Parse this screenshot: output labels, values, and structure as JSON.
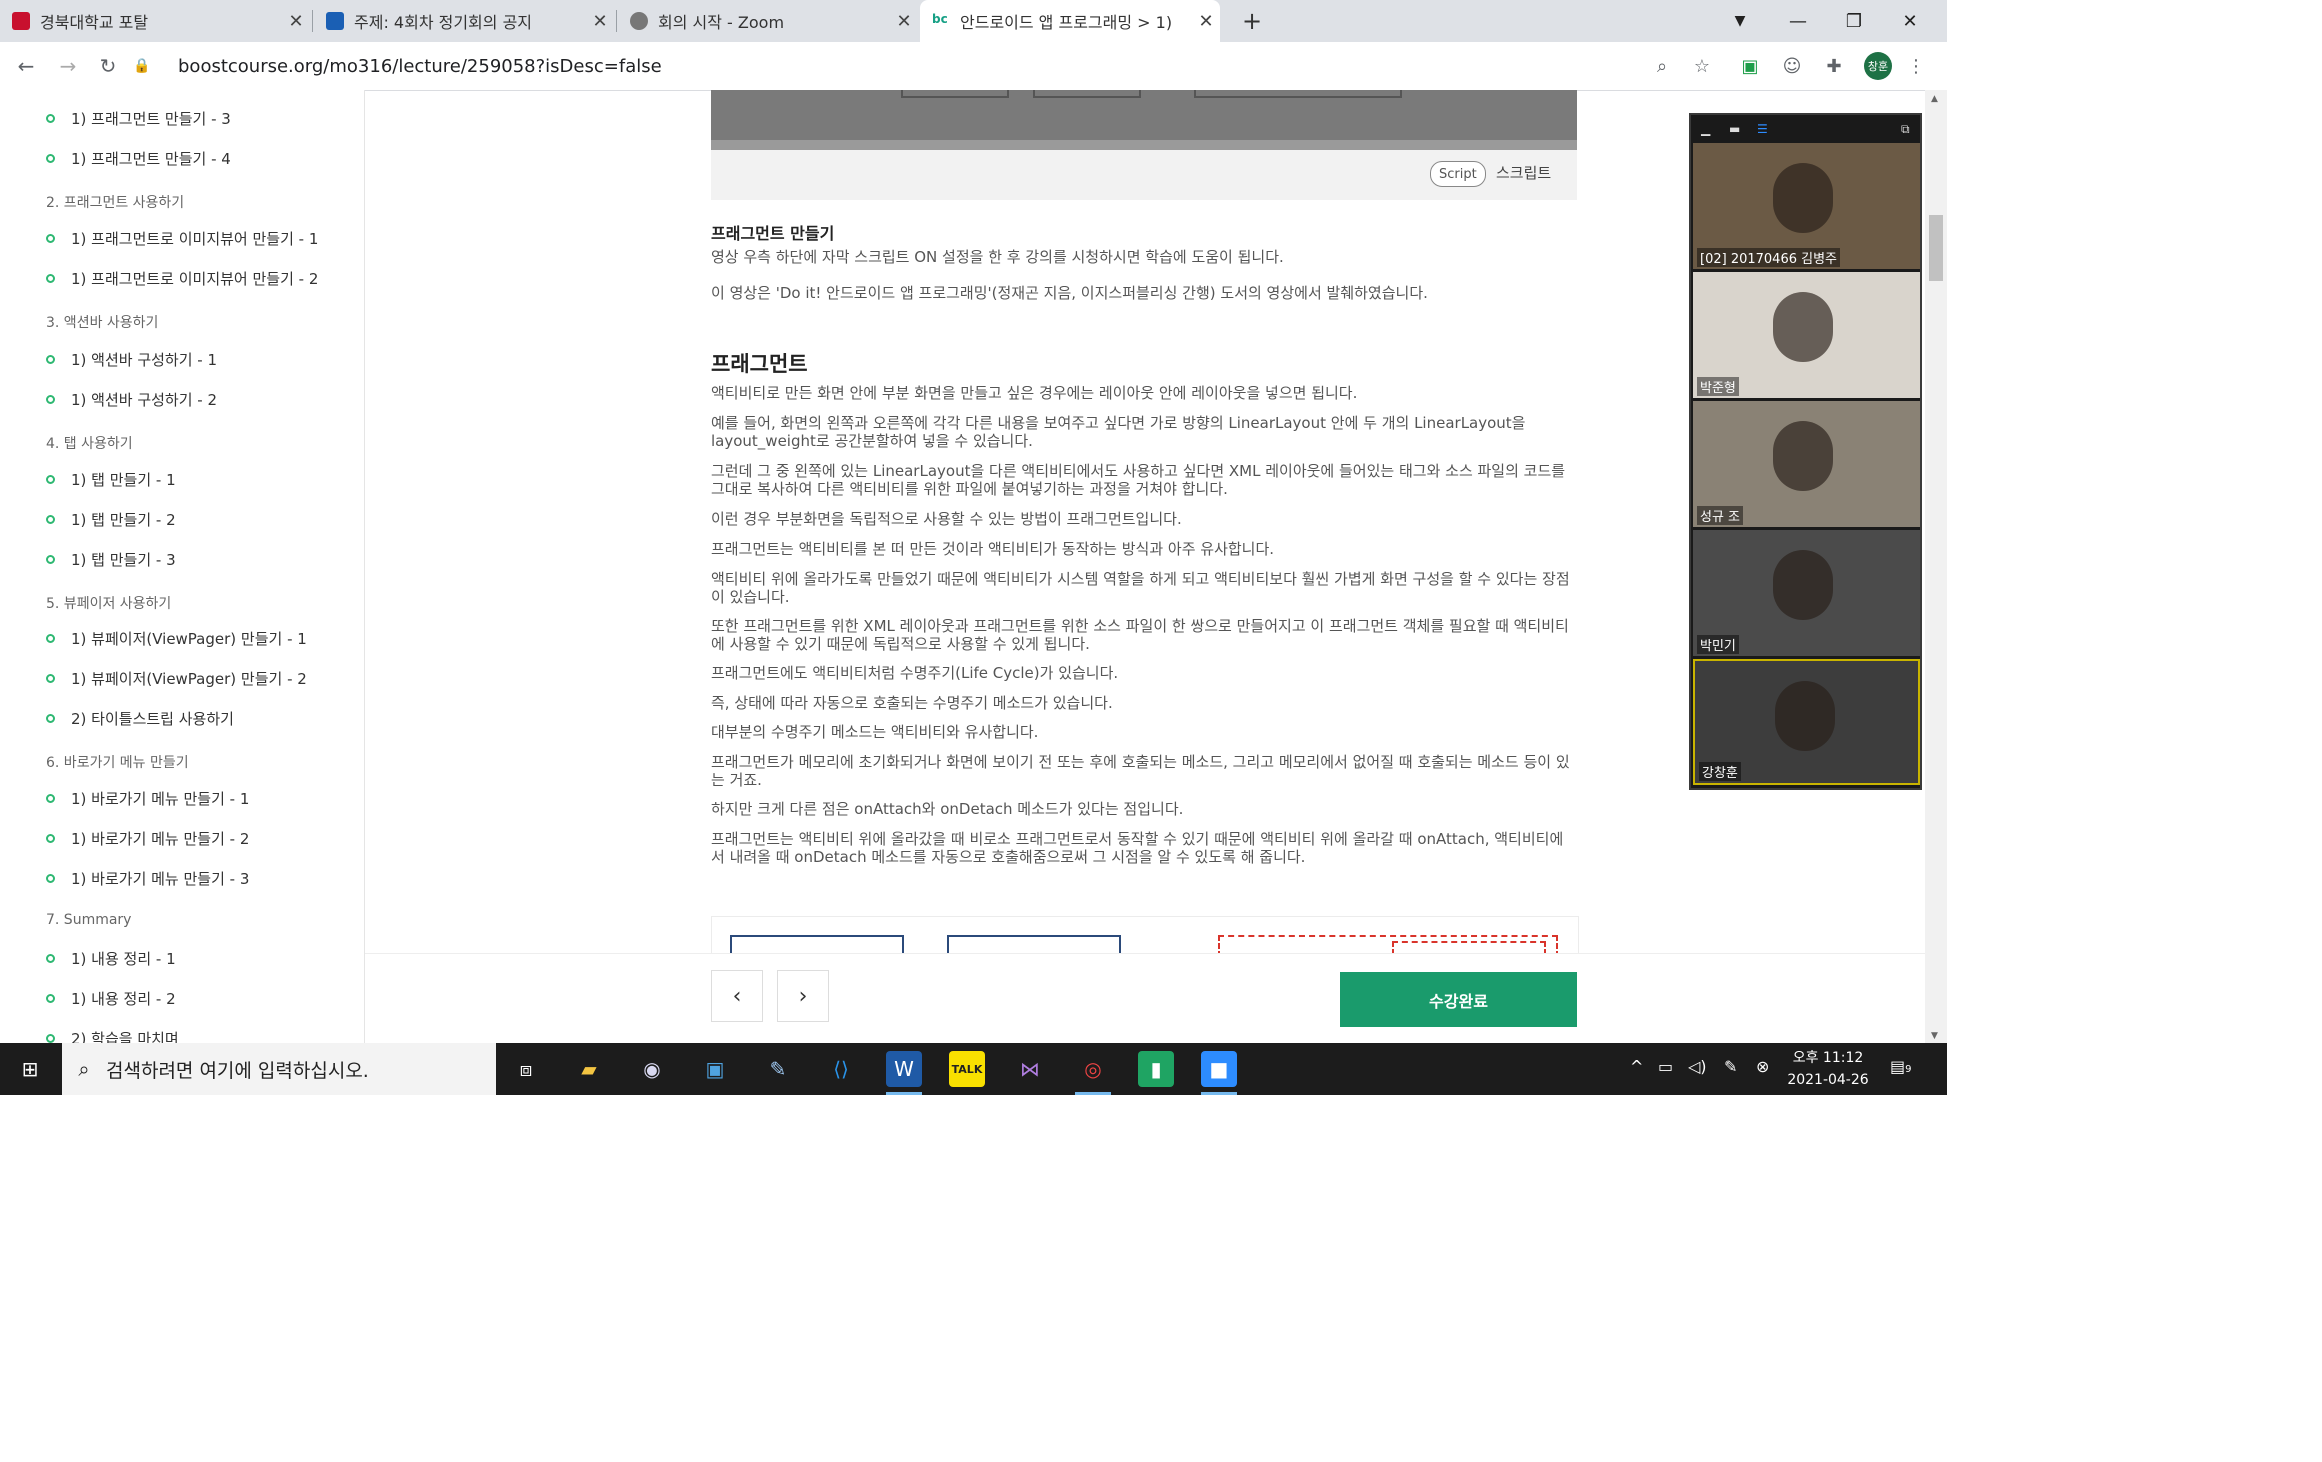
{
  "browser": {
    "tabs": [
      {
        "title": "경북대학교 포탈",
        "favicon_color": "#c8102e",
        "active": false
      },
      {
        "title": "주제: 4회차 정기회의 공지",
        "favicon_color": "#1a5fb4",
        "active": false
      },
      {
        "title": "회의 시작 - Zoom",
        "favicon_color": "#777777",
        "active": false
      },
      {
        "title": "안드로이드 앱 프로그래밍 > 1)",
        "favicon_color": "#16a085",
        "favicon_text": "bc",
        "active": true
      }
    ],
    "new_tab_label": "+",
    "url": "boostcourse.org/mo316/lecture/259058?isDesc=false",
    "profile_label": "창훈"
  },
  "sidebar": {
    "entries": [
      {
        "type": "item",
        "label": "1) 프래그먼트 만들기 - 3"
      },
      {
        "type": "item",
        "label": "1) 프래그먼트 만들기 - 4"
      },
      {
        "type": "section",
        "label": "2. 프래그먼트 사용하기"
      },
      {
        "type": "item",
        "label": "1) 프래그먼트로 이미지뷰어 만들기 - 1"
      },
      {
        "type": "item",
        "label": "1) 프래그먼트로 이미지뷰어 만들기 - 2"
      },
      {
        "type": "section",
        "label": "3. 액션바 사용하기"
      },
      {
        "type": "item",
        "label": "1) 액션바 구성하기 - 1"
      },
      {
        "type": "item",
        "label": "1) 액션바 구성하기 - 2"
      },
      {
        "type": "section",
        "label": "4. 탭 사용하기"
      },
      {
        "type": "item",
        "label": "1) 탭 만들기 - 1"
      },
      {
        "type": "item",
        "label": "1) 탭 만들기 - 2"
      },
      {
        "type": "item",
        "label": "1) 탭 만들기 - 3"
      },
      {
        "type": "section",
        "label": "5. 뷰페이저 사용하기"
      },
      {
        "type": "item",
        "label": "1) 뷰페이저(ViewPager) 만들기 - 1"
      },
      {
        "type": "item",
        "label": "1) 뷰페이저(ViewPager) 만들기 - 2"
      },
      {
        "type": "item",
        "label": "2) 타이틀스트립 사용하기"
      },
      {
        "type": "section",
        "label": "6. 바로가기 메뉴 만들기"
      },
      {
        "type": "item",
        "label": "1) 바로가기 메뉴 만들기 - 1"
      },
      {
        "type": "item",
        "label": "1) 바로가기 메뉴 만들기 - 2"
      },
      {
        "type": "item",
        "label": "1) 바로가기 메뉴 만들기 - 3"
      },
      {
        "type": "section",
        "label": "7. Summary"
      },
      {
        "type": "item",
        "label": "1) 내용 정리 - 1"
      },
      {
        "type": "item",
        "label": "1) 내용 정리 - 2"
      },
      {
        "type": "item",
        "label": "2) 학습을 마치며"
      }
    ]
  },
  "content": {
    "script_badge": "Script",
    "script_label": "스크립트",
    "section_title": "프래그먼트 만들기",
    "intro": [
      "영상 우측 하단에 자막 스크립트 ON 설정을 한 후 강의를 시청하시면 학습에 도움이 됩니다.",
      "이 영상은 'Do it! 안드로이드 앱 프로그래밍'(정재곤 지음, 이지스퍼블리싱 간행) 도서의 영상에서 발췌하였습니다."
    ],
    "heading": "프래그먼트",
    "paragraphs": [
      "액티비티로 만든 화면 안에 부분 화면을 만들고 싶은 경우에는 레이아웃 안에 레이아웃을 넣으면 됩니다.",
      "예를 들어, 화면의 왼쪽과 오른쪽에 각각 다른 내용을 보여주고 싶다면 가로 방향의 LinearLayout 안에 두 개의 LinearLayout을 layout_weight로 공간분할하여 넣을 수 있습니다.",
      "그런데 그 중 왼쪽에 있는 LinearLayout을 다른 액티비티에서도 사용하고 싶다면 XML 레이아웃에 들어있는 태그와 소스 파일의 코드를 그대로 복사하여 다른 액티비티를 위한 파일에 붙여넣기하는 과정을 거쳐야 합니다.",
      "이런 경우 부분화면을 독립적으로 사용할 수 있는 방법이 프래그먼트입니다.",
      "프래그먼트는 액티비티를 본 떠 만든 것이라 액티비티가 동작하는 방식과 아주 유사합니다.",
      "액티비티 위에 올라가도록 만들었기 때문에 액티비티가 시스템 역할을 하게 되고 액티비티보다 훨씬 가볍게 화면 구성을 할 수 있다는 장점이 있습니다.",
      "또한 프래그먼트를 위한 XML 레이아웃과 프래그먼트를 위한 소스 파일이 한 쌍으로 만들어지고 이 프래그먼트 객체를 필요할 때 액티비티에 사용할 수 있기 때문에 독립적으로 사용할 수 있게 됩니다.",
      "프래그먼트에도 액티비티처럼 수명주기(Life Cycle)가 있습니다.",
      "즉, 상태에 따라 자동으로 호출되는 수명주기 메소드가 있습니다.",
      "대부분의 수명주기 메소드는 액티비티와 유사합니다.",
      "프래그먼트가 메모리에 초기화되거나 화면에 보이기 전 또는 후에 호출되는 메소드, 그리고 메모리에서 없어질 때 호출되는 메소드 등이 있는 거죠.",
      "하지만 크게 다른 점은 onAttach와 onDetach 메소드가 있다는 점입니다.",
      "프래그먼트는 액티비티 위에 올라갔을 때 비로소 프래그먼트로서 동작할 수 있기 때문에 액티비티 위에 올라갈 때 onAttach, 액티비티에서 내려올 때 onDetach 메소드를 자동으로 호출해줌으로써 그 시점을 알 수 있도록 해 줍니다."
    ]
  },
  "footer": {
    "prev_label": "‹",
    "next_label": "›",
    "complete_label": "수강완료"
  },
  "zoom": {
    "participants": [
      {
        "name": "[02] 20170466 김병주",
        "bg": "#6b5a45"
      },
      {
        "name": "박준형",
        "bg": "#d9d4cc"
      },
      {
        "name": "성규 조",
        "bg": "#8a8275"
      },
      {
        "name": "박민기",
        "bg": "#4b4b4b"
      },
      {
        "name": "강창훈",
        "bg": "#3d3d3d"
      }
    ]
  },
  "taskbar": {
    "search_placeholder": "검색하려면 여기에 입력하십시오.",
    "time": "오후 11:12",
    "date": "2021-04-26",
    "notification_count": "9"
  }
}
